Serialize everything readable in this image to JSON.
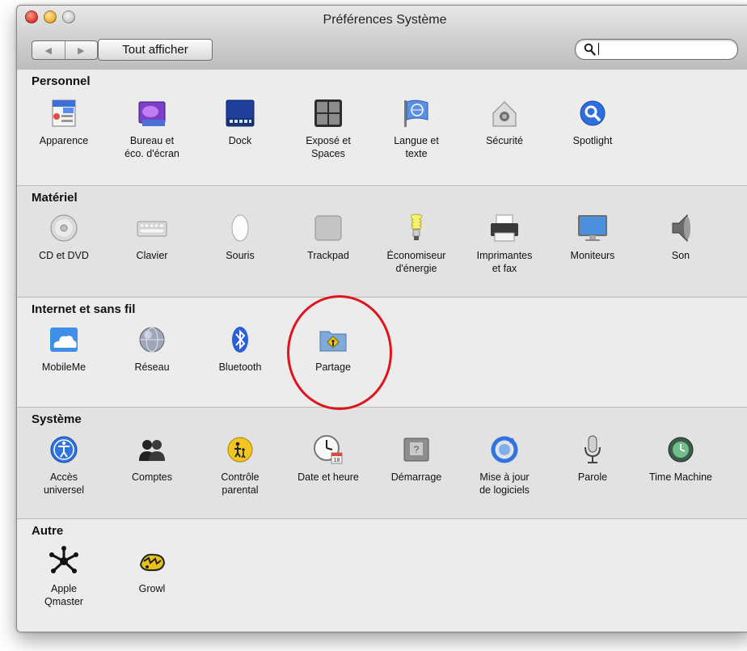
{
  "window": {
    "title": "Préférences Système"
  },
  "toolbar": {
    "back_glyph": "◀",
    "forward_glyph": "▶",
    "show_all_label": "Tout afficher"
  },
  "search": {
    "value": "",
    "placeholder": "",
    "icon": "magnifier-icon"
  },
  "sections": {
    "personnel": {
      "title": "Personnel",
      "items": [
        {
          "label": "Apparence",
          "icon": "appearance-icon"
        },
        {
          "label": "Bureau et\néco. d'écran",
          "icon": "desktop-screensaver-icon"
        },
        {
          "label": "Dock",
          "icon": "dock-icon"
        },
        {
          "label": "Exposé et\nSpaces",
          "icon": "expose-spaces-icon"
        },
        {
          "label": "Langue et\ntexte",
          "icon": "language-flag-icon"
        },
        {
          "label": "Sécurité",
          "icon": "security-house-icon"
        },
        {
          "label": "Spotlight",
          "icon": "spotlight-icon"
        }
      ]
    },
    "materiel": {
      "title": "Matériel",
      "items": [
        {
          "label": "CD et DVD",
          "icon": "cd-dvd-icon"
        },
        {
          "label": "Clavier",
          "icon": "keyboard-icon"
        },
        {
          "label": "Souris",
          "icon": "mouse-icon"
        },
        {
          "label": "Trackpad",
          "icon": "trackpad-icon"
        },
        {
          "label": "Économiseur\nd'énergie",
          "icon": "energy-bulb-icon"
        },
        {
          "label": "Imprimantes\net fax",
          "icon": "printer-icon"
        },
        {
          "label": "Moniteurs",
          "icon": "monitor-icon"
        },
        {
          "label": "Son",
          "icon": "speaker-icon"
        }
      ]
    },
    "internet": {
      "title": "Internet et sans fil",
      "items": [
        {
          "label": "MobileMe",
          "icon": "cloud-icon"
        },
        {
          "label": "Réseau",
          "icon": "network-globe-icon"
        },
        {
          "label": "Bluetooth",
          "icon": "bluetooth-icon"
        },
        {
          "label": "Partage",
          "icon": "sharing-folder-icon"
        }
      ]
    },
    "systeme": {
      "title": "Système",
      "items": [
        {
          "label": "Accès\nuniversel",
          "icon": "accessibility-icon"
        },
        {
          "label": "Comptes",
          "icon": "accounts-icon"
        },
        {
          "label": "Contrôle\nparental",
          "icon": "parental-controls-icon"
        },
        {
          "label": "Date et heure",
          "icon": "clock-calendar-icon"
        },
        {
          "label": "Démarrage",
          "icon": "startup-disk-icon"
        },
        {
          "label": "Mise à jour\nde logiciels",
          "icon": "software-update-icon"
        },
        {
          "label": "Parole",
          "icon": "microphone-icon"
        },
        {
          "label": "Time Machine",
          "icon": "time-machine-icon"
        }
      ]
    },
    "autre": {
      "title": "Autre",
      "items": [
        {
          "label": "Apple\nQmaster",
          "icon": "qmaster-icon"
        },
        {
          "label": "Growl",
          "icon": "growl-icon"
        }
      ]
    }
  },
  "annotation": {
    "highlighted_item": "Partage",
    "color": "#e0141e"
  }
}
